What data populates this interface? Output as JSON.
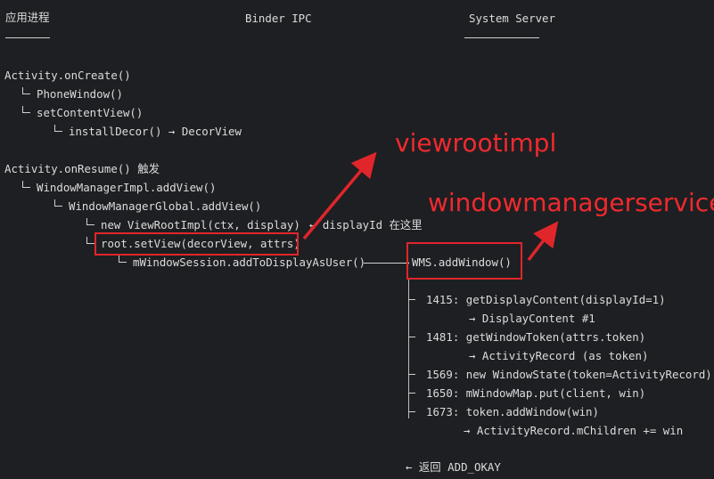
{
  "columns": {
    "app": "应用进程",
    "binder": "Binder IPC",
    "system": "System Server"
  },
  "app_lines": {
    "l1": "Activity.onCreate()",
    "l2": "PhoneWindow()",
    "l3": "setContentView()",
    "l4": "installDecor() → DecorView",
    "l5": "Activity.onResume() 触发",
    "l6": "WindowManagerImpl.addView()",
    "l7": "WindowManagerGlobal.addView()",
    "l8": "new ViewRootImpl(ctx, display)",
    "l8_note": "← displayId 在这里",
    "l9": "root.setView(decorView, attrs)",
    "l10": "mWindowSession.addToDisplayAsUser()"
  },
  "system_lines": {
    "wms": "WMS.addWindow()",
    "s1": "1415: getDisplayContent(displayId=1)",
    "s1r": "→ DisplayContent #1",
    "s2": "1481: getWindowToken(attrs.token)",
    "s2r": "→ ActivityRecord (as token)",
    "s3": "1569: new WindowState(token=ActivityRecord)",
    "s4": "1650: mWindowMap.put(client, win)",
    "s5": "1673: token.addWindow(win)",
    "s5r": "→ ActivityRecord.mChildren += win",
    "ret": "← 返回 ADD_OKAY"
  },
  "annotations": {
    "viewrootimpl": "viewrootimpl",
    "wms": "windowmanagerservice"
  },
  "colors": {
    "background": "#1e1f22",
    "text": "#dcdcdc",
    "annotation_red": "#e0262b"
  }
}
